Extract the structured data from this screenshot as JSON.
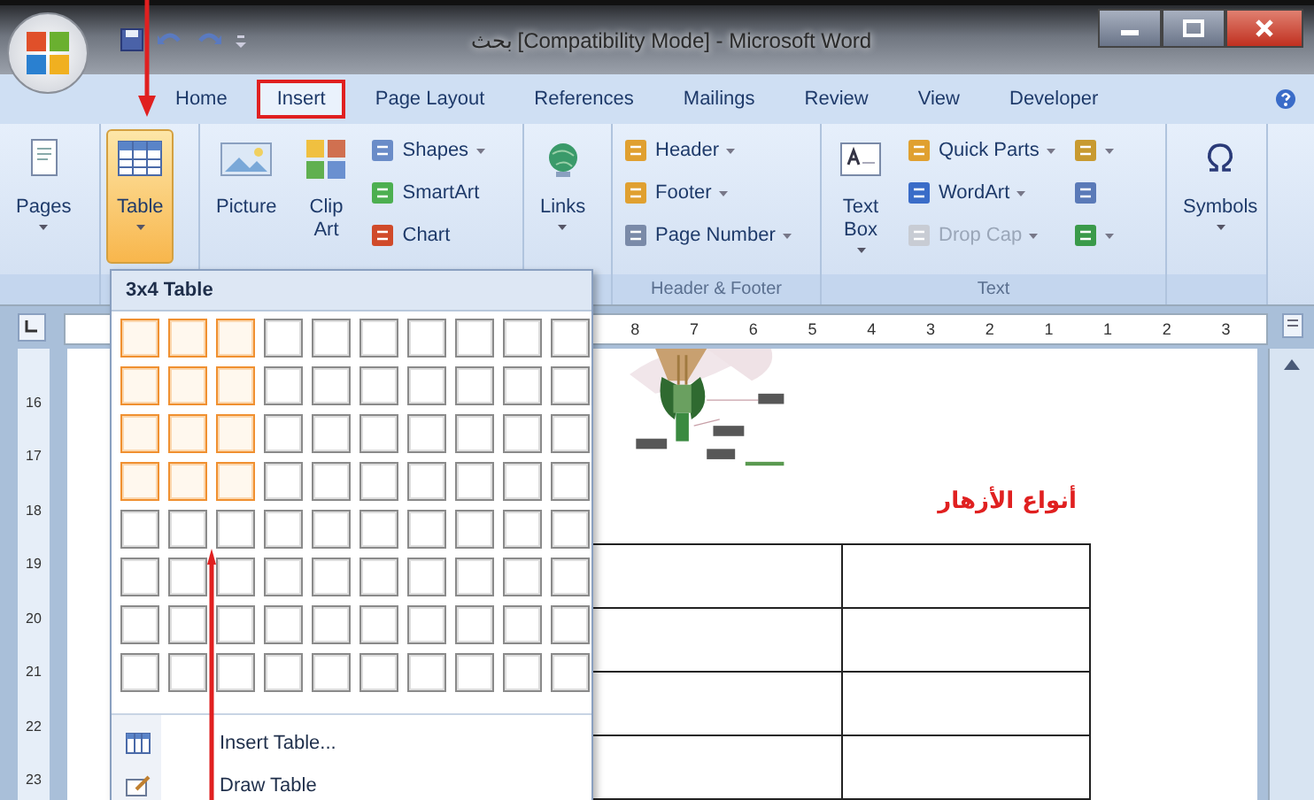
{
  "window": {
    "title": "بحث [Compatibility Mode] - Microsoft Word"
  },
  "tabs": [
    {
      "label": "Home",
      "selected": false
    },
    {
      "label": "Insert",
      "selected": true
    },
    {
      "label": "Page Layout",
      "selected": false
    },
    {
      "label": "References",
      "selected": false
    },
    {
      "label": "Mailings",
      "selected": false
    },
    {
      "label": "Review",
      "selected": false
    },
    {
      "label": "View",
      "selected": false
    },
    {
      "label": "Developer",
      "selected": false
    }
  ],
  "ribbon": {
    "groups": [
      {
        "items": [
          {
            "kind": "large",
            "lines": [
              "Pages"
            ],
            "dropdown": true,
            "selected": false,
            "disabled": false
          }
        ]
      },
      {
        "items": [
          {
            "kind": "large",
            "lines": [
              "Table"
            ],
            "dropdown": true,
            "selected": true,
            "disabled": false
          }
        ]
      },
      {
        "items": [
          {
            "kind": "large",
            "lines": [
              "Picture"
            ],
            "dropdown": false,
            "selected": false,
            "disabled": false
          },
          {
            "kind": "large",
            "lines": [
              "Clip",
              "Art"
            ],
            "dropdown": false,
            "selected": false,
            "disabled": false
          },
          {
            "kind": "small",
            "label": "Shapes",
            "dropdown": true,
            "selected": false,
            "disabled": false
          },
          {
            "kind": "small",
            "label": "SmartArt",
            "dropdown": false,
            "selected": false,
            "disabled": false
          },
          {
            "kind": "small",
            "label": "Chart",
            "dropdown": false,
            "selected": false,
            "disabled": false
          }
        ]
      },
      {
        "items": [
          {
            "kind": "large",
            "lines": [
              "Links"
            ],
            "dropdown": true,
            "selected": false,
            "disabled": false
          }
        ]
      },
      {
        "label": "Header & Footer",
        "items": [
          {
            "kind": "small",
            "label": "Header",
            "dropdown": true,
            "selected": false,
            "disabled": false
          },
          {
            "kind": "small",
            "label": "Footer",
            "dropdown": true,
            "selected": false,
            "disabled": false
          },
          {
            "kind": "small",
            "label": "Page Number",
            "dropdown": true,
            "selected": false,
            "disabled": false
          }
        ]
      },
      {
        "label": "Text",
        "items": [
          {
            "kind": "large",
            "lines": [
              "Text",
              "Box"
            ],
            "dropdown": true,
            "selected": false,
            "disabled": false
          },
          {
            "kind": "small",
            "label": "Quick Parts",
            "dropdown": true,
            "selected": false,
            "disabled": false
          },
          {
            "kind": "small",
            "label": "WordArt",
            "dropdown": true,
            "selected": false,
            "disabled": false
          },
          {
            "kind": "small",
            "label": "Drop Cap",
            "dropdown": true,
            "selected": false,
            "disabled": true
          },
          {
            "kind": "icon",
            "dropdown": true,
            "selected": false,
            "disabled": false
          },
          {
            "kind": "icon",
            "dropdown": false,
            "selected": false,
            "disabled": false
          },
          {
            "kind": "icon",
            "dropdown": true,
            "selected": false,
            "disabled": false
          }
        ]
      },
      {
        "items": [
          {
            "kind": "large",
            "lines": [
              "Symbols"
            ],
            "dropdown": true,
            "selected": false,
            "disabled": false
          }
        ]
      }
    ]
  },
  "ruler": {
    "marks": [
      "8",
      "7",
      "6",
      "5",
      "4",
      "3",
      "2",
      "1",
      "1",
      "2",
      "3"
    ]
  },
  "vertical_ruler": {
    "marks": [
      "16",
      "17",
      "18",
      "19",
      "20",
      "21",
      "22",
      "23"
    ]
  },
  "document": {
    "heading": "أنواع الأزهار"
  },
  "dropdown": {
    "title": "3x4 Table",
    "grid": [
      {
        "cells": [
          {
            "selected": true
          },
          {
            "selected": true
          },
          {
            "selected": true
          },
          {
            "selected": false
          },
          {
            "selected": false
          },
          {
            "selected": false
          },
          {
            "selected": false
          },
          {
            "selected": false
          },
          {
            "selected": false
          },
          {
            "selected": false
          }
        ]
      },
      {
        "cells": [
          {
            "selected": true
          },
          {
            "selected": true
          },
          {
            "selected": true
          },
          {
            "selected": false
          },
          {
            "selected": false
          },
          {
            "selected": false
          },
          {
            "selected": false
          },
          {
            "selected": false
          },
          {
            "selected": false
          },
          {
            "selected": false
          }
        ]
      },
      {
        "cells": [
          {
            "selected": true
          },
          {
            "selected": true
          },
          {
            "selected": true
          },
          {
            "selected": false
          },
          {
            "selected": false
          },
          {
            "selected": false
          },
          {
            "selected": false
          },
          {
            "selected": false
          },
          {
            "selected": false
          },
          {
            "selected": false
          }
        ]
      },
      {
        "cells": [
          {
            "selected": true
          },
          {
            "selected": true
          },
          {
            "selected": true
          },
          {
            "selected": false
          },
          {
            "selected": false
          },
          {
            "selected": false
          },
          {
            "selected": false
          },
          {
            "selected": false
          },
          {
            "selected": false
          },
          {
            "selected": false
          }
        ]
      },
      {
        "cells": [
          {
            "selected": false
          },
          {
            "selected": false
          },
          {
            "selected": false
          },
          {
            "selected": false
          },
          {
            "selected": false
          },
          {
            "selected": false
          },
          {
            "selected": false
          },
          {
            "selected": false
          },
          {
            "selected": false
          },
          {
            "selected": false
          }
        ]
      },
      {
        "cells": [
          {
            "selected": false
          },
          {
            "selected": false
          },
          {
            "selected": false
          },
          {
            "selected": false
          },
          {
            "selected": false
          },
          {
            "selected": false
          },
          {
            "selected": false
          },
          {
            "selected": false
          },
          {
            "selected": false
          },
          {
            "selected": false
          }
        ]
      },
      {
        "cells": [
          {
            "selected": false
          },
          {
            "selected": false
          },
          {
            "selected": false
          },
          {
            "selected": false
          },
          {
            "selected": false
          },
          {
            "selected": false
          },
          {
            "selected": false
          },
          {
            "selected": false
          },
          {
            "selected": false
          },
          {
            "selected": false
          }
        ]
      },
      {
        "cells": [
          {
            "selected": false
          },
          {
            "selected": false
          },
          {
            "selected": false
          },
          {
            "selected": false
          },
          {
            "selected": false
          },
          {
            "selected": false
          },
          {
            "selected": false
          },
          {
            "selected": false
          },
          {
            "selected": false
          },
          {
            "selected": false
          }
        ]
      }
    ],
    "menu": [
      {
        "label": "Insert Table..."
      },
      {
        "label": "Draw Table"
      }
    ]
  }
}
